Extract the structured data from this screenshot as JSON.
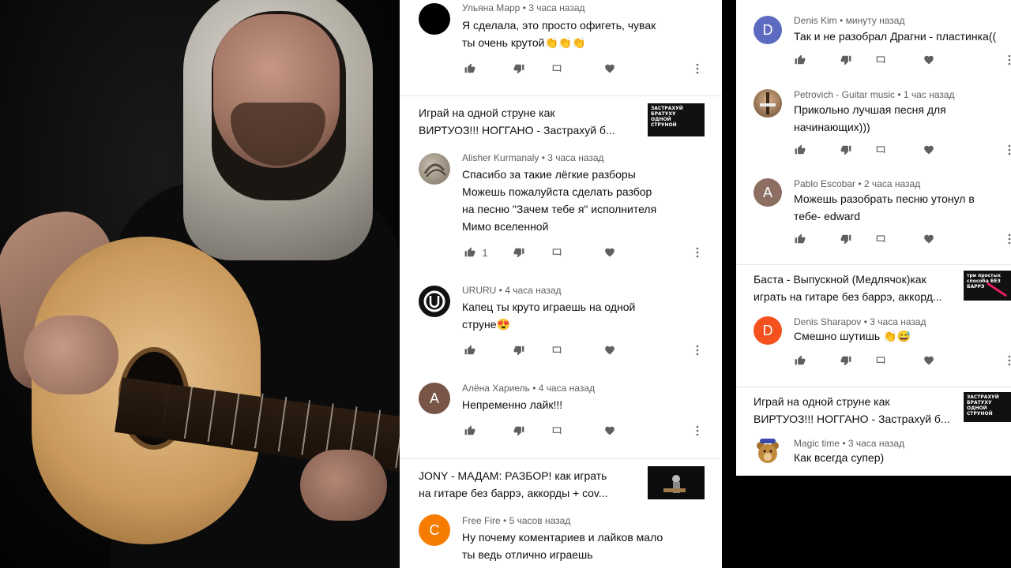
{
  "colors": {
    "panel_bg": "#ffffff",
    "meta_text": "#606060",
    "body_text": "#0f0f0f",
    "action_icon": "#606060",
    "avatar_a": "#795548",
    "avatar_c": "#f57c00",
    "avatar_d_blue": "#5c6bc0",
    "avatar_d_orange": "#f4511e"
  },
  "left_panel": {
    "comments": [
      {
        "author": "Ульяна Марр",
        "time": "3 часа назад",
        "text_lines": [
          "Я сделала, это просто офигеть, чувак",
          "ты очень крутой👏👏👏"
        ],
        "avatar_icon": "black-circle-avatar",
        "likes": ""
      },
      {
        "author": "Alisher Kurmanaly",
        "time": "3 часа назад",
        "text_lines": [
          "Спасибо за такие лёгкие разборы",
          "Можешь пожалуйста сделать разбор",
          "на песню \"Зачем тебе я\" исполнителя",
          "Мимо вселенной"
        ],
        "avatar_icon": "shell-photo-avatar",
        "likes": "1"
      },
      {
        "author": "URURU",
        "time": "4 часа назад",
        "text_lines": [
          "Капец ты круто играешь на одной",
          "струне😍"
        ],
        "avatar_icon": "u-logo-avatar",
        "likes": ""
      },
      {
        "author": "Алёна Хариель",
        "time": "4 часа назад",
        "text_lines": [
          "Непременно лайк!!!"
        ],
        "avatar_letter": "A",
        "likes": ""
      },
      {
        "author": "Free Fire",
        "time": "5 часов назад",
        "text_lines": [
          "Ну почему коментариев и лайков мало",
          "ты ведь отлично играешь"
        ],
        "avatar_letter": "C",
        "likes": ""
      }
    ],
    "videos": [
      {
        "title_lines": [
          "Играй на одной струне как",
          "ВИРТУОЗ!!! НОГГАНО - Застрахуй б..."
        ],
        "thumb_text": "ЗАСТРАХУЙ БРАТУХУ ОДНОЙ СТРУНОЙ"
      },
      {
        "title_lines": [
          "JONY - МАДАМ: РАЗБОР! как играть",
          "на гитаре без баррэ, аккорды + cov..."
        ],
        "thumb_text": ""
      }
    ]
  },
  "right_panel": {
    "comments": [
      {
        "author": "Denis Kim",
        "time": "минуту назад",
        "text_lines": [
          "Так и не разобрал Драгни - пластинка(("
        ],
        "avatar_letter": "D"
      },
      {
        "author": "Petrovich - Guitar music",
        "time": "1 час назад",
        "text_lines": [
          "Прикольно лучшая песня для",
          "начинающих)))"
        ],
        "avatar_icon": "guitar-photo-avatar"
      },
      {
        "author": "Pablo Escobar",
        "time": "2 часа назад",
        "text_lines": [
          "Можешь разобрать песню утонул в",
          "тебе- edward"
        ],
        "avatar_letter": "A"
      },
      {
        "author": "Denis Sharapov",
        "time": "3 часа назад",
        "text_lines": [
          "Смешно шутишь 👏😅"
        ],
        "avatar_letter": "D"
      },
      {
        "author": "Magic time",
        "time": "3 часа назад",
        "text_lines": [
          "Как всегда супер)"
        ],
        "avatar_icon": "teddy-bear-avatar"
      }
    ],
    "videos": [
      {
        "title_lines": [
          "Баста - Выпускной (Медлячок)как",
          "играть на гитаре без баррэ, аккорд..."
        ],
        "thumb_text": "три простых способа   БЕЗ БАРРЭ"
      },
      {
        "title_lines": [
          "Играй на одной струне как",
          "ВИРТУОЗ!!! НОГГАНО - Застрахуй б..."
        ],
        "thumb_text": "ЗАСТРАХУЙ БРАТУХУ ОДНОЙ СТРУНОЙ"
      }
    ]
  },
  "meta_separator": " • "
}
